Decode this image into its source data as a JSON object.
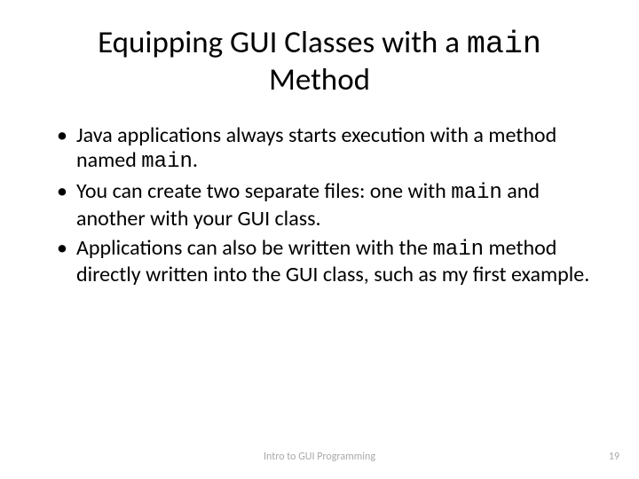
{
  "title": {
    "part1": "Equipping GUI Classes with a ",
    "code": "main",
    "part2": " Method"
  },
  "bullets": [
    {
      "pre": "Java applications always starts execution with a method named ",
      "code": "main",
      "post": "."
    },
    {
      "pre": "You can create two separate files: one with ",
      "code": "main",
      "post": " and another with your GUI class."
    },
    {
      "pre": "Applications can also be written with the ",
      "code": "main",
      "post": " method directly written into the GUI class, such as my first example."
    }
  ],
  "footer": "Intro to GUI Programming",
  "page_number": "19"
}
